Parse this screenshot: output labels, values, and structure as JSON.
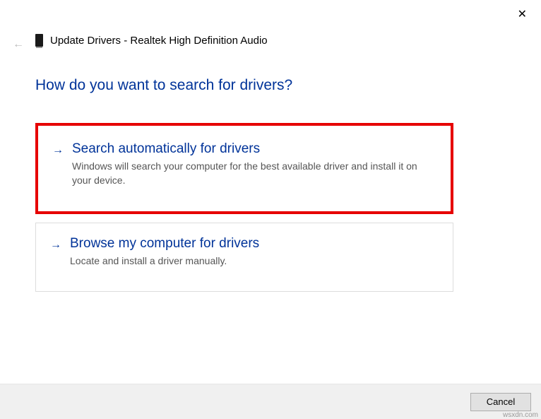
{
  "window": {
    "title": "Update Drivers - Realtek High Definition Audio"
  },
  "main": {
    "question": "How do you want to search for drivers?"
  },
  "options": {
    "auto": {
      "title": "Search automatically for drivers",
      "desc": "Windows will search your computer for the best available driver and install it on your device."
    },
    "browse": {
      "title": "Browse my computer for drivers",
      "desc": "Locate and install a driver manually."
    }
  },
  "footer": {
    "cancel": "Cancel"
  },
  "watermark": "wsxdn.com"
}
